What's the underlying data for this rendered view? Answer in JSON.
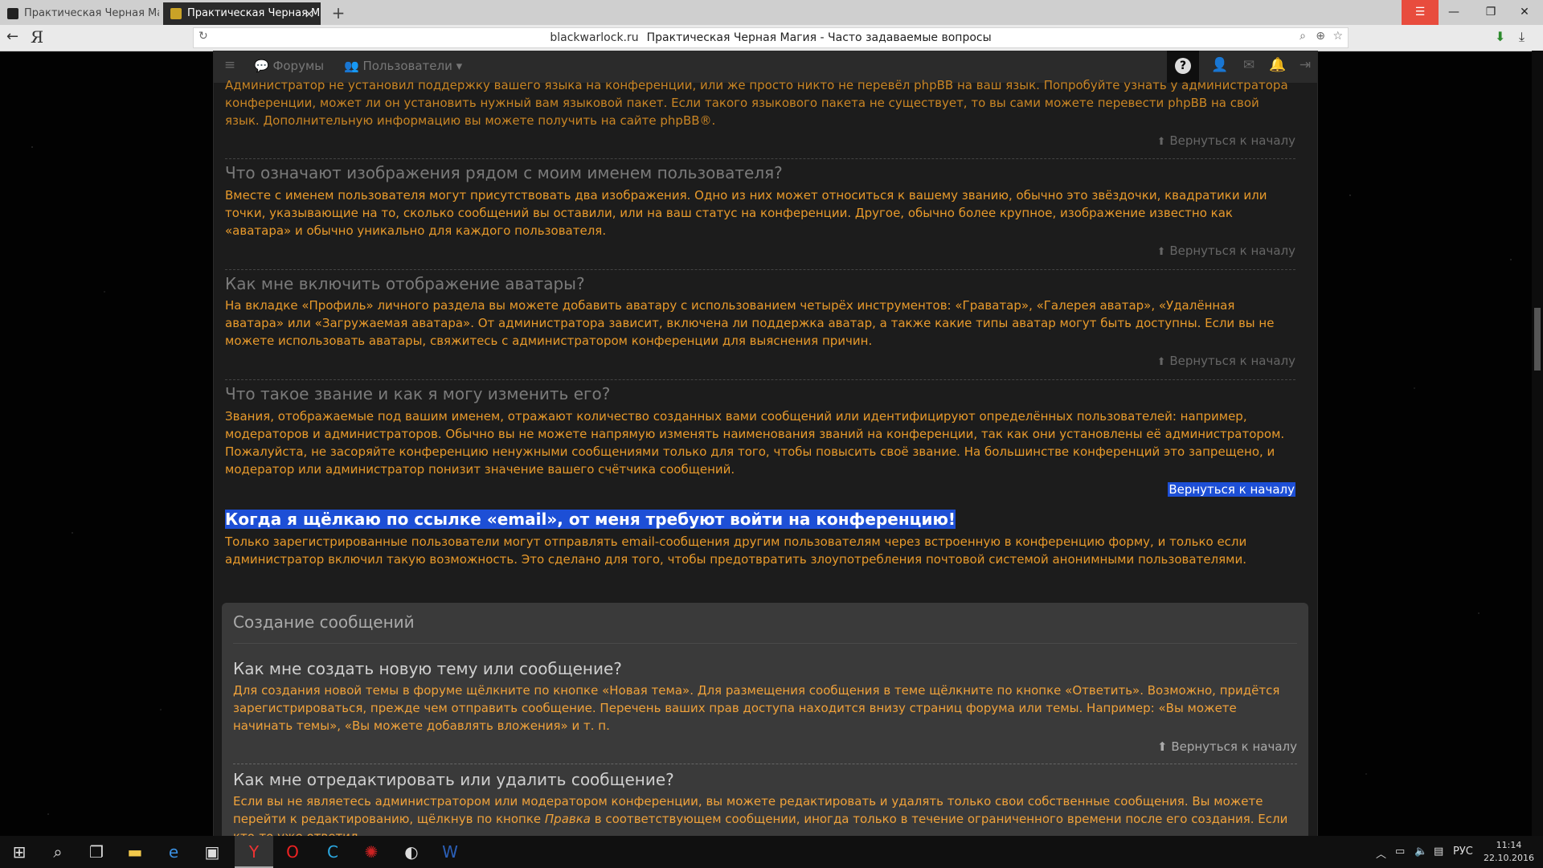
{
  "browser": {
    "tabs": [
      {
        "title": "Практическая Черная Магия"
      },
      {
        "title": "Практическая Черная Магия - Часто задаваемые вопросы",
        "close": "×"
      }
    ],
    "new_tab": "+",
    "address": {
      "domain": "blackwarlock.ru",
      "page_title": "Практическая Черная Магия - Часто задаваемые вопросы"
    },
    "yandex_logo": "Я"
  },
  "navbar": {
    "forums_label": "Форумы",
    "users_label": "Пользователи",
    "help_label": "?"
  },
  "faq": {
    "intro_tail": "Администратор не установил поддержку вашего языка на конференции, или же просто никто не перевёл phpBB на ваш язык. Попробуйте узнать у администратора конференции, может ли он установить нужный вам языковой пакет. Если такого языкового пакета не существует, то вы сами можете перевести phpBB на свой язык. Дополнительную информацию вы можете получить на сайте phpBB®.",
    "back_to_top": "Вернуться к началу",
    "items": [
      {
        "q": "Что означают изображения рядом с моим именем пользователя?",
        "a": "Вместе с именем пользователя могут присутствовать два изображения. Одно из них может относиться к вашему званию, обычно это звёздочки, квадратики или точки, указывающие на то, сколько сообщений вы оставили, или на ваш статус на конференции. Другое, обычно более крупное, изображение известно как «аватара» и обычно уникально для каждого пользователя."
      },
      {
        "q": "Как мне включить отображение аватары?",
        "a": "На вкладке «Профиль» личного раздела вы можете добавить аватару с использованием четырёх инструментов: «Граватар», «Галерея аватар», «Удалённая аватара» или «Загружаемая аватара». От администратора зависит, включена ли поддержка аватар, а также какие типы аватар могут быть доступны. Если вы не можете использовать аватары, свяжитесь с администратором конференции для выяснения причин."
      },
      {
        "q": "Что такое звание и как я могу изменить его?",
        "a": "Звания, отображаемые под вашим именем, отражают количество созданных вами сообщений или идентифицируют определённых пользователей: например, модераторов и администраторов. Обычно вы не можете напрямую изменять наименования званий на конференции, так как они установлены её администратором. Пожалуйста, не засоряйте конференцию ненужными сообщениями только для того, чтобы повысить своё звание. На большинстве конференций это запрещено, и модератор или администратор понизит значение вашего счётчика сообщений."
      },
      {
        "q": "Когда я щёлкаю по ссылке «email», от меня требуют войти на конференцию!",
        "a": "Только зарегистрированные пользователи могут отправлять email-сообщения другим пользователям через встроенную в конференцию форму, и только если администратор включил такую возможность. Это сделано для того, чтобы предотвратить злоупотребления почтовой системой анонимными пользователями."
      }
    ]
  },
  "posting": {
    "section_title": "Создание сообщений",
    "q1": "Как мне создать новую тему или сообщение?",
    "a1": "Для создания новой темы в форуме щёлкните по кнопке «Новая тема». Для размещения сообщения в теме щёлкните по кнопке «Ответить». Возможно, придётся зарегистрироваться, прежде чем отправить сообщение. Перечень ваших прав доступа находится внизу страниц форума или темы. Например: «Вы можете начинать темы», «Вы можете добавлять вложения» и т. п.",
    "q2": "Как мне отредактировать или удалить сообщение?",
    "a2_before": "Если вы не являетесь администратором или модератором конференции, вы можете редактировать и удалять только свои собственные сообщения. Вы можете перейти к редактированию, щёлкнув по кнопке ",
    "a2_em": "Правка",
    "a2_after": " в соответствующем сообщении, иногда только в течение ограниченного времени после его создания. Если кто-то уже ответил"
  },
  "taskbar": {
    "lang": "РУС",
    "time": "11:14",
    "date": "22.10.2016"
  },
  "colors": {
    "accent_orange": "#e89a2b",
    "highlight_blue": "#1d4fd6"
  }
}
